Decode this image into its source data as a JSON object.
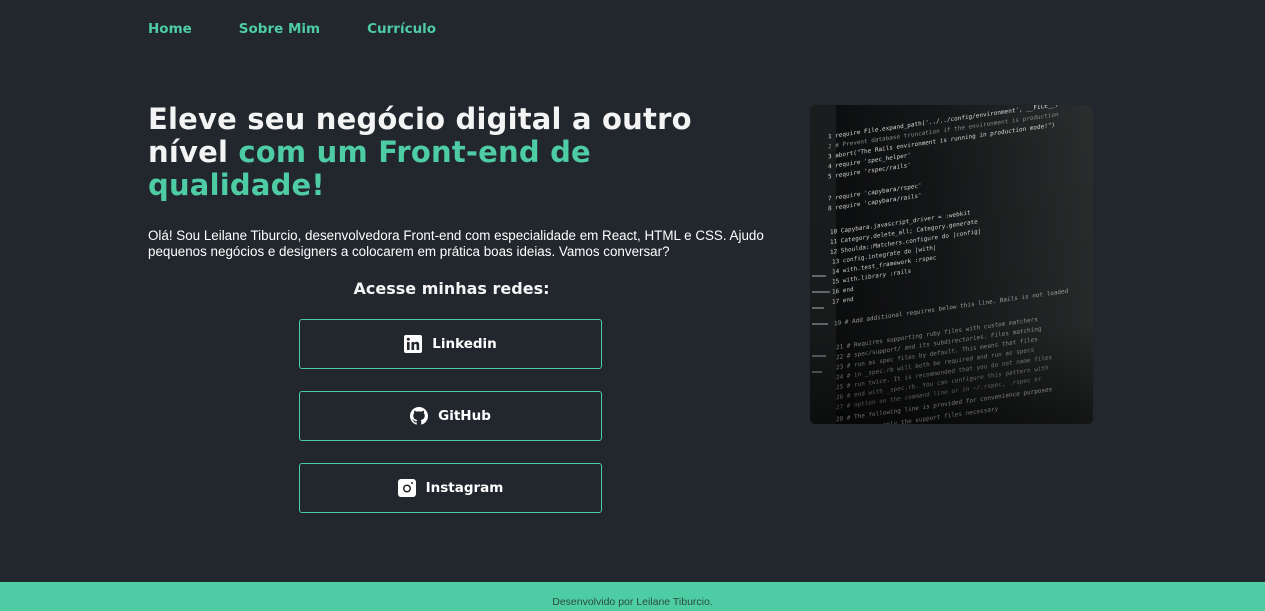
{
  "nav": {
    "items": [
      {
        "label": "Home"
      },
      {
        "label": "Sobre Mim"
      },
      {
        "label": "Currículo"
      }
    ]
  },
  "hero": {
    "title_part1": "Eleve seu negócio digital a outro nível ",
    "title_accent": "com um Front-end de qualidade!",
    "intro": "Olá! Sou Leilane Tiburcio, desenvolvedora Front-end com especialidade em React, HTML e CSS. Ajudo pequenos negócios e designers a colocarem em prática boas ideias. Vamos conversar?"
  },
  "socials": {
    "title": "Acesse minhas redes:",
    "items": [
      {
        "label": "Linkedin",
        "icon": "linkedin-icon"
      },
      {
        "label": "GitHub",
        "icon": "github-icon"
      },
      {
        "label": "Instagram",
        "icon": "instagram-icon"
      }
    ]
  },
  "footer": {
    "text": "Desenvolvido por Leilane Tiburcio."
  },
  "colors": {
    "background": "#22272e",
    "accent": "#4ecca3",
    "text": "#f4f4f4"
  }
}
